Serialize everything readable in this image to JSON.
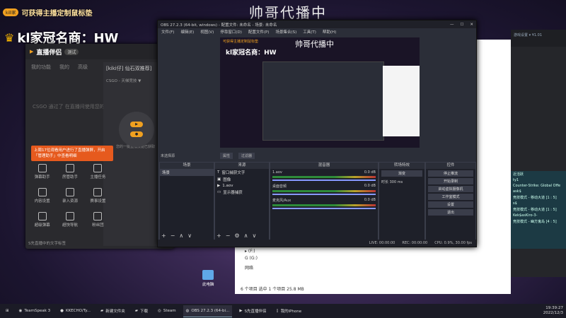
{
  "overlay": {
    "promo_pill": "kill家",
    "promo_text": "可获得主播定制鼠标垫",
    "crowned_name": "kl家冠名商：HW",
    "stream_title": "帅哥代播中"
  },
  "live_assistant": {
    "logo": "直播伴侣",
    "version": "测试",
    "tabs": [
      "我的功能",
      "我的",
      "高级"
    ],
    "empty_text": "CSGO 通过了 在直播间使用您的收藏",
    "game_tag": "[kiki仔] 仙石双推荐]",
    "game_sub": "CSGO - 天梯竞技 ▼",
    "tip": "上周17位观看用户进行了直播弹屏，开启「管理助手」中查看明细",
    "side_text": "您的一键直播技能已获取",
    "grid": [
      "弹幕助手",
      "房管助手",
      "主播任务",
      "内容设置",
      "录入资源",
      "赛事设置",
      "超级弹幕",
      "超快导航",
      "粉丝团"
    ],
    "footer": "S先直播中的文字标签"
  },
  "file_explorer": {
    "rows": [
      "▸ (F:)",
      "G (G:)",
      "网络"
    ],
    "status": "6 个项目  选中 1 个项目  25.8 MB"
  },
  "right_app": {
    "header": "游戏设置 ▾ ¥1.01",
    "list": [
      "近活跃",
      "ty1",
      "Counter-Strike: Global Offe",
      "ask$",
      "竞技模式 - 移动大道 [1 : 5]",
      "s$",
      "竞技模式 - 移动大道 [1 : 5]",
      "Kek$asKiro-3-",
      "竞技模式 - 幽方鬼岛 [4 : 5]",
      "tom$",
      "竞技模式 - 无热小镇 [1 : 5]",
      "tan",
      "竞技模式 - 无热小镇 [1 : 5]"
    ]
  },
  "obs": {
    "title": "OBS 27.2.3 (64-bit, windows) - 配置文件: 未命名 - 场景: 未命名",
    "menu": [
      "文件(F)",
      "编辑(E)",
      "视图(V)",
      "停靠窗口(D)",
      "配置文件(P)",
      "场景集合(S)",
      "工具(T)",
      "帮助(H)"
    ],
    "scene_bar": "未选择源",
    "scene_bar_buttons": [
      "属性",
      "过滤器"
    ],
    "docks": {
      "scenes": "场景",
      "sources": "来源",
      "mixer": "混音器",
      "transitions": "转场特效",
      "controls": "控件"
    },
    "scene_list": [
      "场景"
    ],
    "sources_list": [
      "窗口捕获文字",
      "图像",
      "1.aov",
      "显示器捕获"
    ],
    "mixer": [
      {
        "name": "1.aov",
        "db": "0.0 dB"
      },
      {
        "name": "桌面音频",
        "db": "0.0 dB"
      },
      {
        "name": "麦克风/Aux",
        "db": "0.0 dB"
      }
    ],
    "transition": "渐变",
    "duration_label": "时长",
    "duration": "300 ms",
    "controls": [
      "停止推流",
      "开始录制",
      "启动虚拟摄像机",
      "工作室模式",
      "设置",
      "退出"
    ],
    "status": [
      "LIVE: 00:00:00",
      "REC: 00:00:00",
      "CPU: 0.9%, 30.00 fps"
    ]
  },
  "desktop_icon": "此电脑",
  "taskbar": {
    "items": [
      "TeamSpeak 3",
      "KKECHO/Ty...",
      "新建文件夹",
      "下载",
      "Steam",
      "OBS 27.2.3 (64-bi...",
      "S先直播伴侣",
      "我的iPhone"
    ],
    "active_index": 5,
    "time": "19:39:27",
    "date": "2022/12/3"
  },
  "colors": {
    "accent": "#f0a020",
    "obs_bg": "#2b2e38",
    "tip_bg": "#e65a1e"
  }
}
